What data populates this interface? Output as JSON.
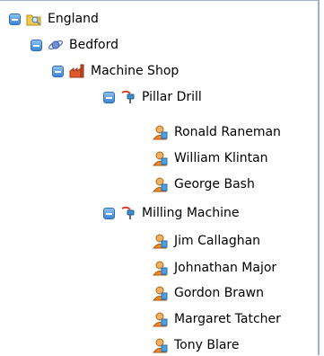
{
  "tree": {
    "nodes": [
      {
        "label": "England",
        "icon": "folder-search-icon",
        "toggle": "collapse"
      },
      {
        "label": "Bedford",
        "icon": "planet-icon",
        "toggle": "collapse"
      },
      {
        "label": "Machine Shop",
        "icon": "factory-icon",
        "toggle": "collapse"
      },
      {
        "label": "Pillar Drill",
        "icon": "drill-icon",
        "toggle": "collapse"
      },
      {
        "label": "Ronald Raneman",
        "icon": "person-icon"
      },
      {
        "label": "William Klintan",
        "icon": "person-icon"
      },
      {
        "label": "George Bash",
        "icon": "person-icon"
      },
      {
        "label": "Milling Machine",
        "icon": "drill-icon",
        "toggle": "collapse"
      },
      {
        "label": "Jim Callaghan",
        "icon": "person-icon"
      },
      {
        "label": "Johnathan Major",
        "icon": "person-icon"
      },
      {
        "label": "Gordon Brawn",
        "icon": "person-icon"
      },
      {
        "label": "Margaret Tatcher",
        "icon": "person-icon"
      },
      {
        "label": "Tony Blare",
        "icon": "person-icon"
      }
    ]
  },
  "colors": {
    "toggle": "#3f86d4",
    "panel_border": "#9fb3c8"
  }
}
